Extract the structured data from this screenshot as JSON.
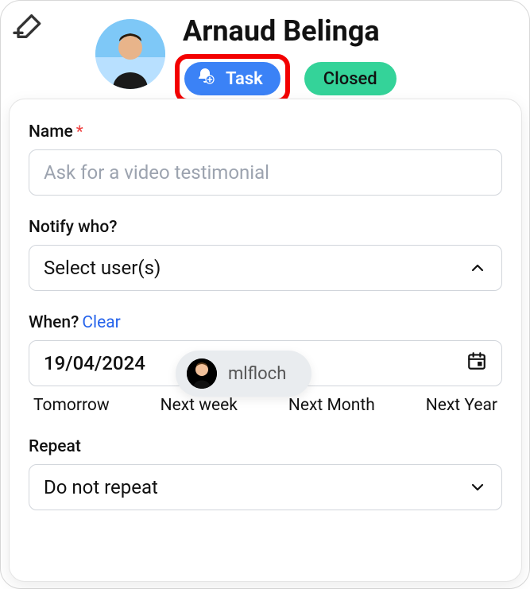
{
  "header": {
    "person_name": "Arnaud Belinga",
    "task_pill_label": "Task",
    "status_pill_label": "Closed"
  },
  "form": {
    "name": {
      "label": "Name",
      "required_mark": "*",
      "placeholder": "Ask for a video testimonial",
      "value": ""
    },
    "notify": {
      "label": "Notify who?",
      "placeholder": "Select user(s)",
      "dropdown_option_user": "mlfloch"
    },
    "when": {
      "label": "When?",
      "clear_label": "Clear",
      "value": "19/04/2024",
      "shortcuts": {
        "tomorrow": "Tomorrow",
        "next_week": "Next week",
        "next_month": "Next Month",
        "next_year": "Next Year"
      }
    },
    "repeat": {
      "label": "Repeat",
      "value": "Do not repeat"
    }
  }
}
